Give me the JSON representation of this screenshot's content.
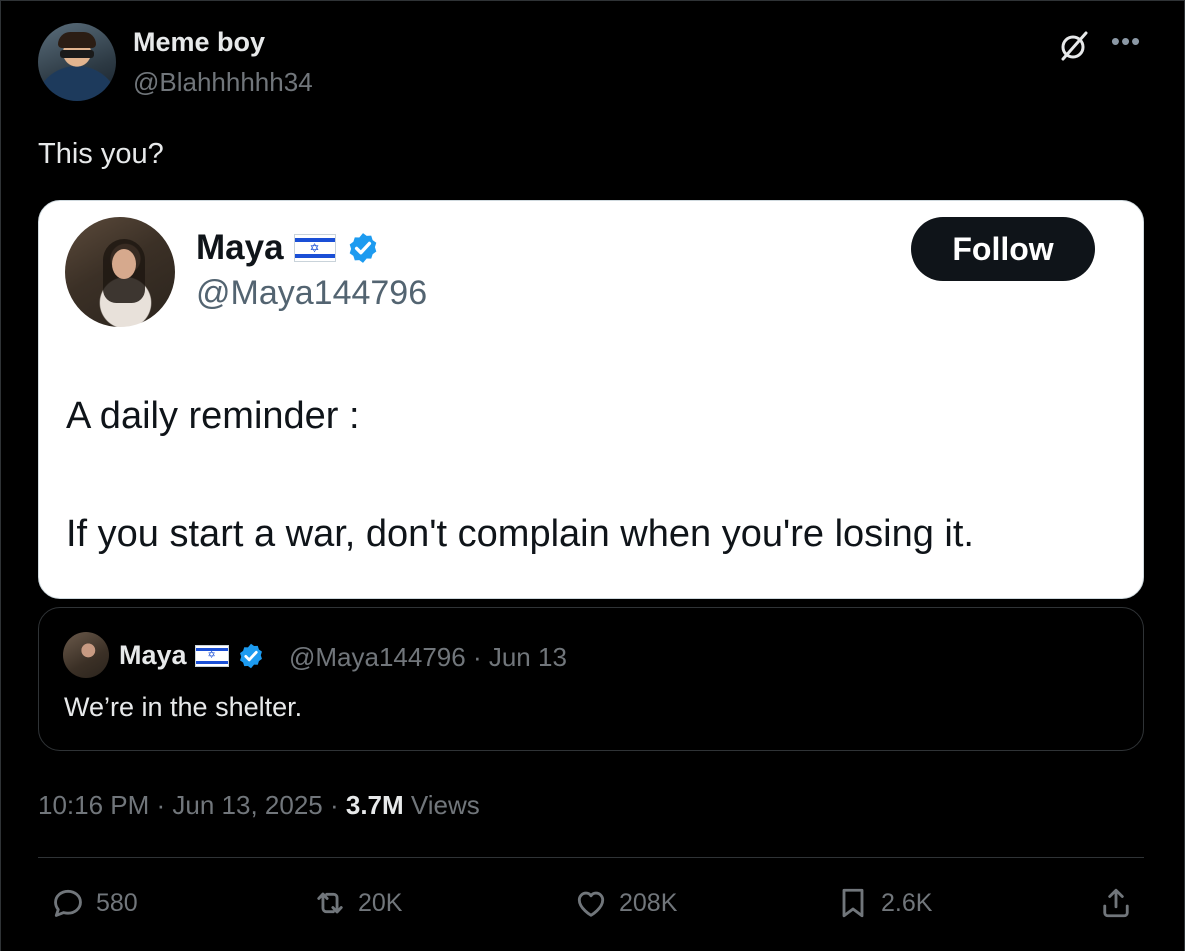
{
  "author": {
    "display_name": "Meme boy",
    "handle": "@Blahhhhhh34"
  },
  "tweet_text": "This you?",
  "screenshot": {
    "name": "Maya",
    "handle": "@Maya144796",
    "follow_label": "Follow",
    "line1": "A daily reminder :",
    "line2": "If you start a war, don't complain when you're losing it."
  },
  "quote": {
    "name": "Maya",
    "meta": "@Maya144796 · Jun 13",
    "text": "We’re in the shelter."
  },
  "meta": {
    "timestamp": "10:16 PM · Jun 13, 2025 · ",
    "views_count": "3.7M",
    "views_label": "Views"
  },
  "actions": {
    "replies": "580",
    "reposts": "20K",
    "likes": "208K",
    "bookmarks": "2.6K"
  },
  "colors": {
    "background": "#000000",
    "verified": "#1d9bf0",
    "muted": "#71767b"
  },
  "icons": [
    "grok-icon",
    "more-icon",
    "verified-icon",
    "israel-flag-icon",
    "reply-icon",
    "repost-icon",
    "like-icon",
    "bookmark-icon",
    "share-icon"
  ]
}
